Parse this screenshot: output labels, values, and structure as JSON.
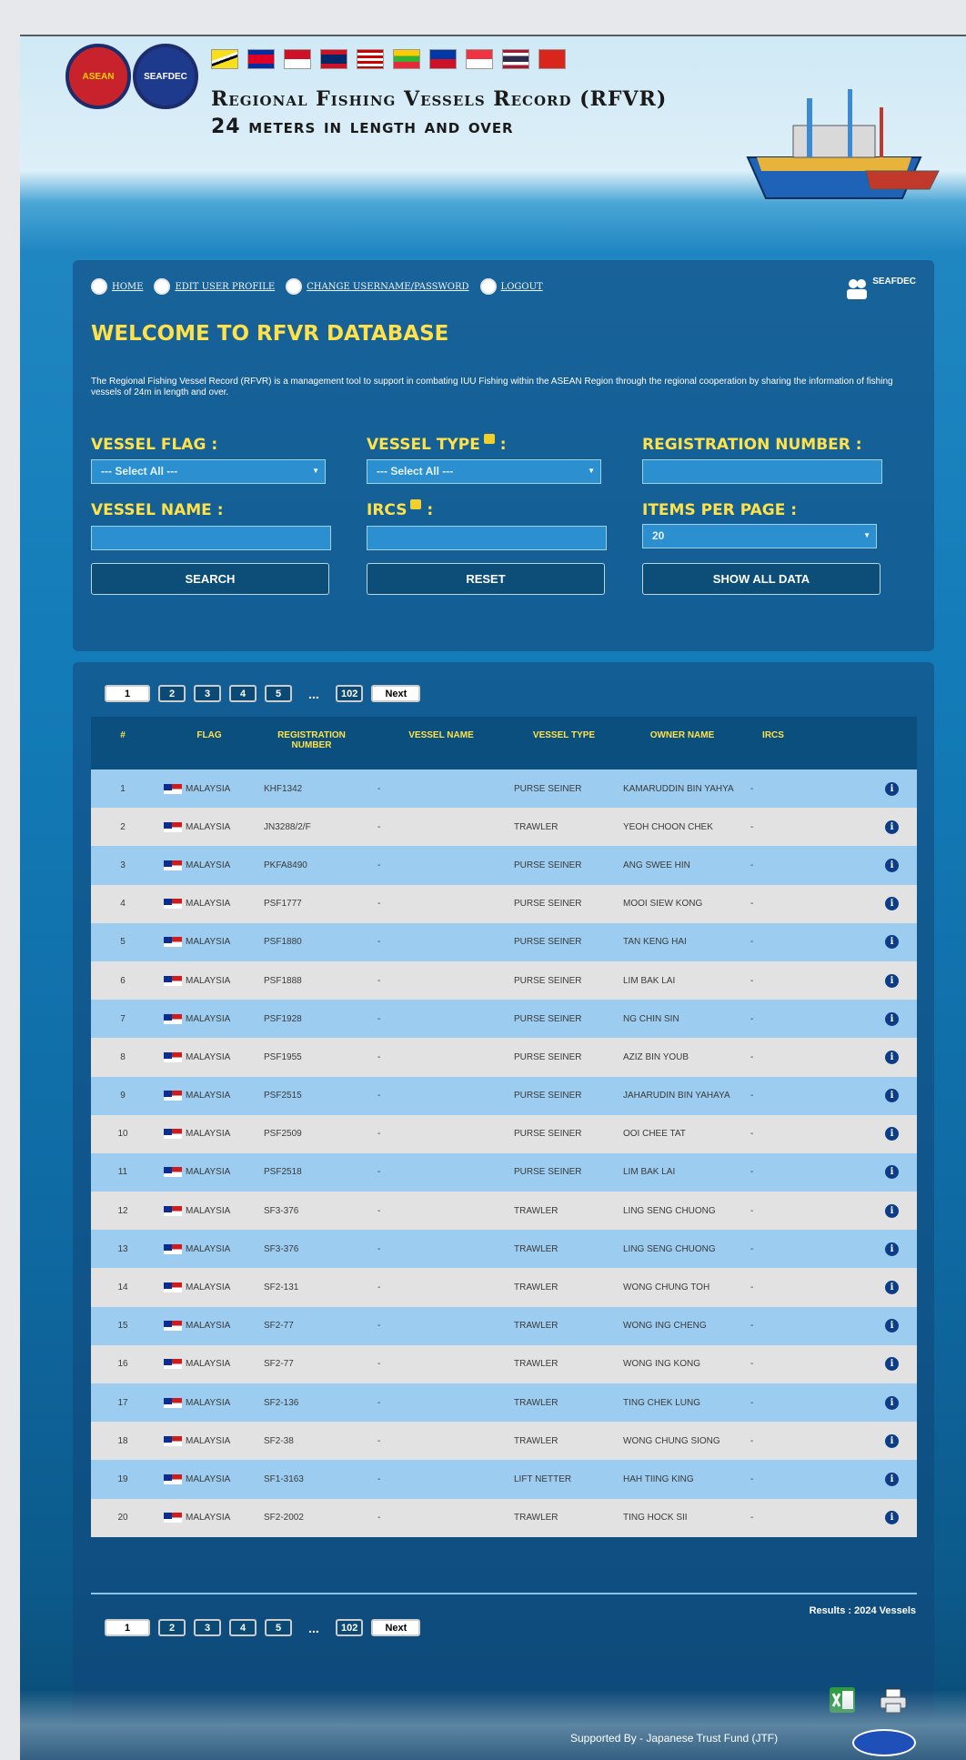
{
  "header": {
    "title": "Regional Fishing Vessels Record (RFVR)",
    "subtitle": "24 meters in length and over",
    "logos": [
      "ASEAN",
      "SEAFDEC"
    ],
    "flag_icons": [
      "brunei-flag-icon",
      "cambodia-flag-icon",
      "indonesia-flag-icon",
      "laos-flag-icon",
      "malaysia-flag-icon",
      "myanmar-flag-icon",
      "philippines-flag-icon",
      "singapore-flag-icon",
      "thailand-flag-icon",
      "vietnam-flag-icon"
    ]
  },
  "nav": {
    "home": "HOME",
    "edit_profile": "EDIT USER PROFILE",
    "change_password": "CHANGE USERNAME/PASSWORD",
    "logout": "LOGOUT",
    "org": "SEAFDEC"
  },
  "welcome": "WELCOME TO RFVR DATABASE",
  "intro": "The Regional Fishing Vessel Record (RFVR) is a management tool to support in combating IUU Fishing within the ASEAN Region through the regional cooperation by sharing the information of fishing vessels of 24m in length and over.",
  "search": {
    "vessel_flag_label": "VESSEL FLAG :",
    "vessel_flag_value": "--- Select All ---",
    "vessel_type_label": "VESSEL TYPE",
    "vessel_type_value": "--- Select All ---",
    "registration_label": "REGISTRATION NUMBER :",
    "registration_value": "",
    "vessel_name_label": "VESSEL NAME :",
    "vessel_name_value": "",
    "ircs_label": "IRCS",
    "ircs_value": "",
    "items_per_page_label": "ITEMS PER PAGE :",
    "items_per_page_value": "20",
    "search_button": "SEARCH",
    "reset_button": "RESET",
    "show_all_button": "SHOW ALL DATA",
    "colon": ":"
  },
  "pager": {
    "pages": [
      "1",
      "2",
      "3",
      "4",
      "5"
    ],
    "ellipsis": "...",
    "last": "102",
    "next": "Next"
  },
  "table": {
    "headers": [
      "#",
      "FLAG",
      "REGISTRATION NUMBER",
      "VESSEL NAME",
      "VESSEL TYPE",
      "OWNER NAME",
      "IRCS"
    ],
    "rows": [
      {
        "n": "1",
        "flag": "MALAYSIA",
        "reg": "KHF1342",
        "name": "-",
        "type": "PURSE SEINER",
        "owner": "KAMARUDDIN BIN YAHYA",
        "ircs": "-"
      },
      {
        "n": "2",
        "flag": "MALAYSIA",
        "reg": "JN3288/2/F",
        "name": "-",
        "type": "TRAWLER",
        "owner": "YEOH CHOON CHEK",
        "ircs": "-"
      },
      {
        "n": "3",
        "flag": "MALAYSIA",
        "reg": "PKFA8490",
        "name": "-",
        "type": "PURSE SEINER",
        "owner": "ANG SWEE HIN",
        "ircs": "-"
      },
      {
        "n": "4",
        "flag": "MALAYSIA",
        "reg": "PSF1777",
        "name": "-",
        "type": "PURSE SEINER",
        "owner": "MOOI SIEW KONG",
        "ircs": "-"
      },
      {
        "n": "5",
        "flag": "MALAYSIA",
        "reg": "PSF1880",
        "name": "-",
        "type": "PURSE SEINER",
        "owner": "TAN KENG HAI",
        "ircs": "-"
      },
      {
        "n": "6",
        "flag": "MALAYSIA",
        "reg": "PSF1888",
        "name": "-",
        "type": "PURSE SEINER",
        "owner": "LIM BAK LAI",
        "ircs": "-"
      },
      {
        "n": "7",
        "flag": "MALAYSIA",
        "reg": "PSF1928",
        "name": "-",
        "type": "PURSE SEINER",
        "owner": "NG CHIN SIN",
        "ircs": "-"
      },
      {
        "n": "8",
        "flag": "MALAYSIA",
        "reg": "PSF1955",
        "name": "-",
        "type": "PURSE SEINER",
        "owner": "AZIZ BIN YOUB",
        "ircs": "-"
      },
      {
        "n": "9",
        "flag": "MALAYSIA",
        "reg": "PSF2515",
        "name": "-",
        "type": "PURSE SEINER",
        "owner": "JAHARUDIN BIN YAHAYA",
        "ircs": "-"
      },
      {
        "n": "10",
        "flag": "MALAYSIA",
        "reg": "PSF2509",
        "name": "-",
        "type": "PURSE SEINER",
        "owner": "OOI CHEE TAT",
        "ircs": "-"
      },
      {
        "n": "11",
        "flag": "MALAYSIA",
        "reg": "PSF2518",
        "name": "-",
        "type": "PURSE SEINER",
        "owner": "LIM BAK LAI",
        "ircs": "-"
      },
      {
        "n": "12",
        "flag": "MALAYSIA",
        "reg": "SF3-376",
        "name": "-",
        "type": "TRAWLER",
        "owner": "LING SENG CHUONG",
        "ircs": "-"
      },
      {
        "n": "13",
        "flag": "MALAYSIA",
        "reg": "SF3-376",
        "name": "-",
        "type": "TRAWLER",
        "owner": "LING SENG CHUONG",
        "ircs": "-"
      },
      {
        "n": "14",
        "flag": "MALAYSIA",
        "reg": "SF2-131",
        "name": "-",
        "type": "TRAWLER",
        "owner": "WONG CHUNG TOH",
        "ircs": "-"
      },
      {
        "n": "15",
        "flag": "MALAYSIA",
        "reg": "SF2-77",
        "name": "-",
        "type": "TRAWLER",
        "owner": "WONG ING CHENG",
        "ircs": "-"
      },
      {
        "n": "16",
        "flag": "MALAYSIA",
        "reg": "SF2-77",
        "name": "-",
        "type": "TRAWLER",
        "owner": "WONG ING KONG",
        "ircs": "-"
      },
      {
        "n": "17",
        "flag": "MALAYSIA",
        "reg": "SF2-136",
        "name": "-",
        "type": "TRAWLER",
        "owner": "TING CHEK LUNG",
        "ircs": "-"
      },
      {
        "n": "18",
        "flag": "MALAYSIA",
        "reg": "SF2-38",
        "name": "-",
        "type": "TRAWLER",
        "owner": "WONG CHUNG SIONG",
        "ircs": "-"
      },
      {
        "n": "19",
        "flag": "MALAYSIA",
        "reg": "SF1-3163",
        "name": "-",
        "type": "LIFT NETTER",
        "owner": "HAH TIING KING",
        "ircs": "-"
      },
      {
        "n": "20",
        "flag": "MALAYSIA",
        "reg": "SF2-2002",
        "name": "-",
        "type": "TRAWLER",
        "owner": "TING HOCK SII",
        "ircs": "-"
      }
    ]
  },
  "results": "Results : 2024 Vessels",
  "footer": "Supported By - Japanese Trust Fund (JTF)",
  "colors": {
    "accent": "#ffe24a",
    "row_odd": "#9ccdf0",
    "row_even": "#e2e2e2",
    "header_bg": "#0a4f7d"
  }
}
